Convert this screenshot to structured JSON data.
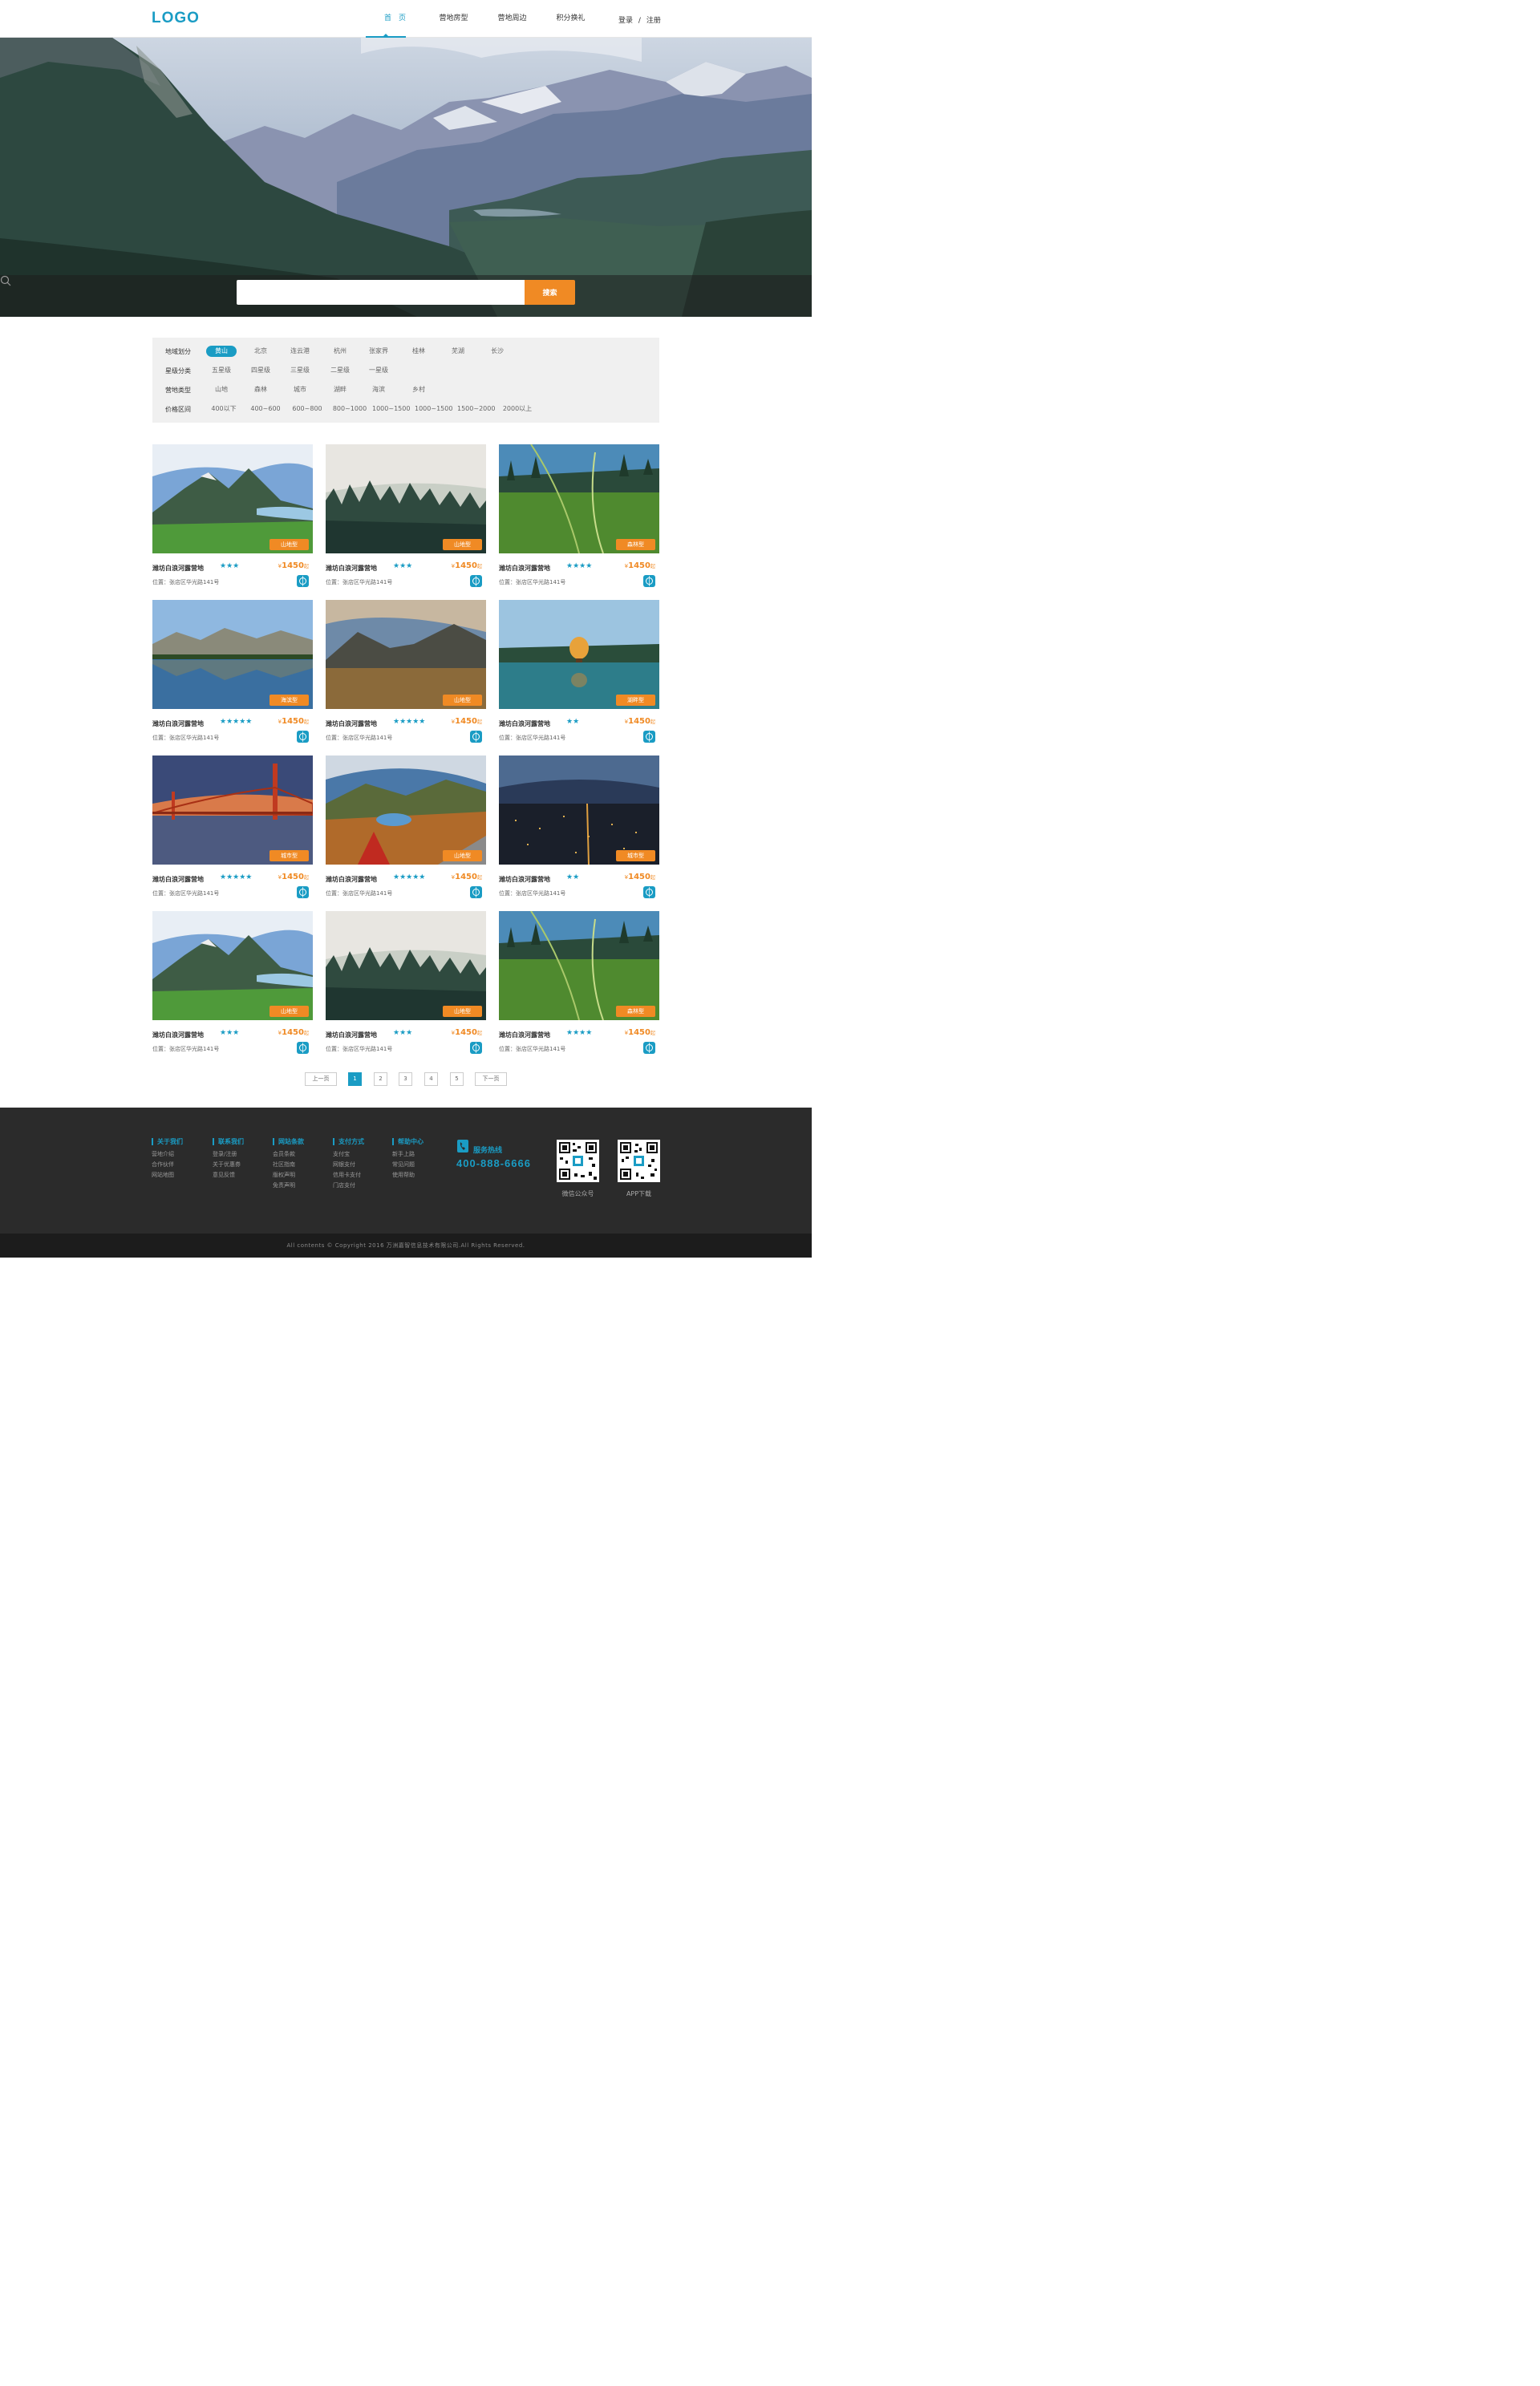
{
  "header": {
    "logo": "LOGO",
    "nav": [
      "首　页",
      "营地房型",
      "营地周边",
      "积分换礼"
    ],
    "login": "登录",
    "divider": "/",
    "register": "注册"
  },
  "search": {
    "placeholder": "",
    "button": "搜索"
  },
  "filters": [
    {
      "label": "地域划分",
      "options": [
        "黄山",
        "北京",
        "连云港",
        "杭州",
        "张家界",
        "桂林",
        "芜湖",
        "长沙"
      ],
      "selected": 0
    },
    {
      "label": "星级分类",
      "options": [
        "五星级",
        "四星级",
        "三星级",
        "二星级",
        "一星级"
      ],
      "selected": -1
    },
    {
      "label": "营地类型",
      "options": [
        "山地",
        "森林",
        "城市",
        "湖畔",
        "海滨",
        "乡村"
      ],
      "selected": -1
    },
    {
      "label": "价格区间",
      "options": [
        "400以下",
        "400~600",
        "600~800",
        "800~1000",
        "1000~1500",
        "1000~1500",
        "1500~2000",
        "2000以上"
      ],
      "selected": -1
    }
  ],
  "cards": [
    {
      "title": "潍坊白浪河露营地",
      "stars": 3,
      "price": "1450",
      "currency": "¥",
      "suffix": "起",
      "address": "位置：张店区华光路141号",
      "tag": "山地型"
    },
    {
      "title": "潍坊白浪河露营地",
      "stars": 3,
      "price": "1450",
      "currency": "¥",
      "suffix": "起",
      "address": "位置：张店区华光路141号",
      "tag": "山地型"
    },
    {
      "title": "潍坊白浪河露营地",
      "stars": 4,
      "price": "1450",
      "currency": "¥",
      "suffix": "起",
      "address": "位置：张店区华光路141号",
      "tag": "森林型"
    },
    {
      "title": "潍坊白浪河露营地",
      "stars": 5,
      "price": "1450",
      "currency": "¥",
      "suffix": "起",
      "address": "位置：张店区华光路141号",
      "tag": "海滨型"
    },
    {
      "title": "潍坊白浪河露营地",
      "stars": 5,
      "price": "1450",
      "currency": "¥",
      "suffix": "起",
      "address": "位置：张店区华光路141号",
      "tag": "山地型"
    },
    {
      "title": "潍坊白浪河露营地",
      "stars": 2,
      "price": "1450",
      "currency": "¥",
      "suffix": "起",
      "address": "位置：张店区华光路141号",
      "tag": "湖畔型"
    },
    {
      "title": "潍坊白浪河露营地",
      "stars": 5,
      "price": "1450",
      "currency": "¥",
      "suffix": "起",
      "address": "位置：张店区华光路141号",
      "tag": "城市型"
    },
    {
      "title": "潍坊白浪河露营地",
      "stars": 5,
      "price": "1450",
      "currency": "¥",
      "suffix": "起",
      "address": "位置：张店区华光路141号",
      "tag": "山地型"
    },
    {
      "title": "潍坊白浪河露营地",
      "stars": 2,
      "price": "1450",
      "currency": "¥",
      "suffix": "起",
      "address": "位置：张店区华光路141号",
      "tag": "城市型"
    },
    {
      "title": "潍坊白浪河露营地",
      "stars": 3,
      "price": "1450",
      "currency": "¥",
      "suffix": "起",
      "address": "位置：张店区华光路141号",
      "tag": "山地型"
    },
    {
      "title": "潍坊白浪河露营地",
      "stars": 3,
      "price": "1450",
      "currency": "¥",
      "suffix": "起",
      "address": "位置：张店区华光路141号",
      "tag": "山地型"
    },
    {
      "title": "潍坊白浪河露营地",
      "stars": 4,
      "price": "1450",
      "currency": "¥",
      "suffix": "起",
      "address": "位置：张店区华光路141号",
      "tag": "森林型"
    }
  ],
  "pagination": {
    "prev": "上一页",
    "pages": [
      "1",
      "2",
      "3",
      "4",
      "5"
    ],
    "current": "1",
    "next": "下一页"
  },
  "footer": {
    "columns": [
      {
        "title": "关于我们",
        "links": [
          "营地介绍",
          "合作伙伴",
          "网站地图"
        ]
      },
      {
        "title": "联系我们",
        "links": [
          "登录/注册",
          "关于优惠券",
          "意见反馈"
        ]
      },
      {
        "title": "网站条款",
        "links": [
          "会员条款",
          "社区指南",
          "版权声明",
          "免责声明"
        ]
      },
      {
        "title": "支付方式",
        "links": [
          "支付宝",
          "网银支付",
          "信用卡支付",
          "门店支付"
        ]
      },
      {
        "title": "帮助中心",
        "links": [
          "新手上路",
          "常见问题",
          "使用帮助"
        ]
      }
    ],
    "hotline_title": "服务热线",
    "hotline": "400-888-6666",
    "qr": [
      {
        "label": "微信公众号"
      },
      {
        "label": "APP下载"
      }
    ],
    "copyright": "All contents © Copyright 2016 万洲嘉智信息技术有限公司.All Rights Reserved."
  },
  "colors": {
    "accent": "#1a9cc4",
    "orange": "#f08a24",
    "footer": "#2b2b2b"
  }
}
